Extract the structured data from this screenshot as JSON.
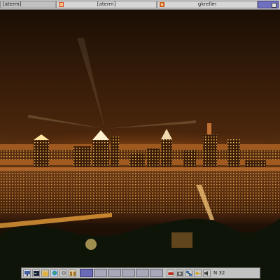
{
  "taskbar": {
    "tasks": [
      {
        "label": "[aterm]",
        "icon": "terminal-icon"
      },
      {
        "label": "[aterm]",
        "icon": "terminal-icon"
      },
      {
        "label": "gkrellm",
        "icon": "gkrellm-icon"
      }
    ],
    "pager_button": "pager-icon"
  },
  "wallpaper": {
    "subject": "",
    "accent": "#f0a030"
  },
  "dock": {
    "launchers": [
      "monitor-icon",
      "terminal-icon",
      "folder-icon",
      "globe-icon",
      "gear-icon",
      "package-icon"
    ],
    "desktops": 4,
    "active_desktop": 1,
    "tray_icons": [
      "gamepad-icon",
      "camera-icon",
      "network-icon",
      "key-icon",
      "speaker-icon"
    ],
    "clock": "N 32"
  }
}
